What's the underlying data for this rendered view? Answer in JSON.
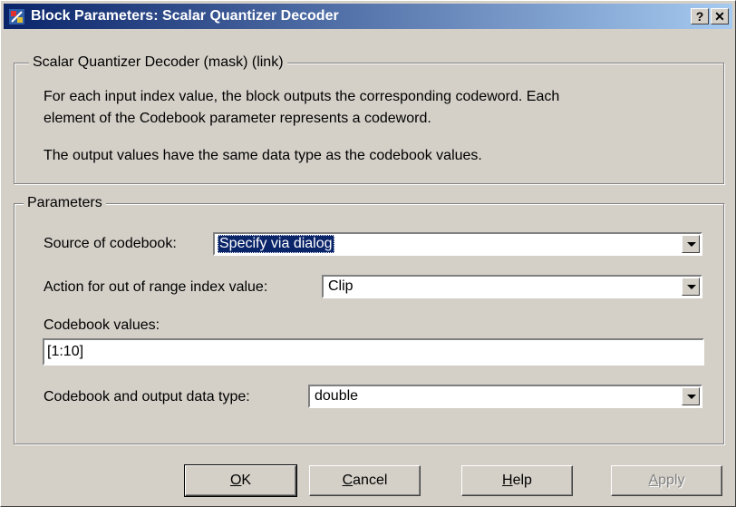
{
  "window": {
    "title": "Block Parameters: Scalar Quantizer Decoder",
    "help_label": "?",
    "close_label": "✕"
  },
  "mask": {
    "legend": "Scalar Quantizer Decoder (mask) (link)",
    "description_1": "For each input index value, the block outputs the corresponding codeword. Each",
    "description_2": "element of the Codebook parameter represents a codeword.",
    "description_3": "The output values have the same data type as the codebook values."
  },
  "parameters": {
    "legend": "Parameters",
    "source_label": "Source of codebook:",
    "source_value": "Specify via dialog",
    "action_label": "Action for out of range index value:",
    "action_value": "Clip",
    "codebook_label": "Codebook values:",
    "codebook_value": "[1:10]",
    "datatype_label": "Codebook and output data type:",
    "datatype_value": "double"
  },
  "buttons": {
    "ok_first": "O",
    "ok_rest": "K",
    "cancel_first": "C",
    "cancel_rest": "ancel",
    "help_first": "H",
    "help_rest": "elp",
    "apply_first": "A",
    "apply_rest": "pply"
  },
  "icons": {
    "app": "simulink-block-icon",
    "dropdown": "chevron-down-icon"
  }
}
